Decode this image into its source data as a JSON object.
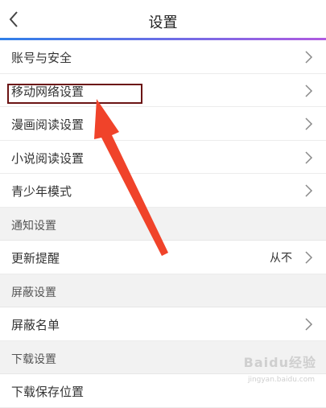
{
  "header": {
    "title": "设置"
  },
  "rows": [
    {
      "label": "账号与安全"
    },
    {
      "label": "移动网络设置"
    },
    {
      "label": "漫画阅读设置"
    },
    {
      "label": "小说阅读设置"
    },
    {
      "label": "青少年模式"
    }
  ],
  "sections": {
    "notify": "通知设置",
    "block": "屏蔽设置",
    "download": "下载设置"
  },
  "update_row": {
    "label": "更新提醒",
    "value": "从不"
  },
  "block_row": {
    "label": "屏蔽名单"
  },
  "download_row": {
    "label": "下载保存位置"
  },
  "watermark": {
    "main": "Baidu经验",
    "sub": "jingyan.baidu.com"
  },
  "colors": {
    "annotation_arrow": "#f0432a",
    "highlight_box": "#6b1414"
  }
}
